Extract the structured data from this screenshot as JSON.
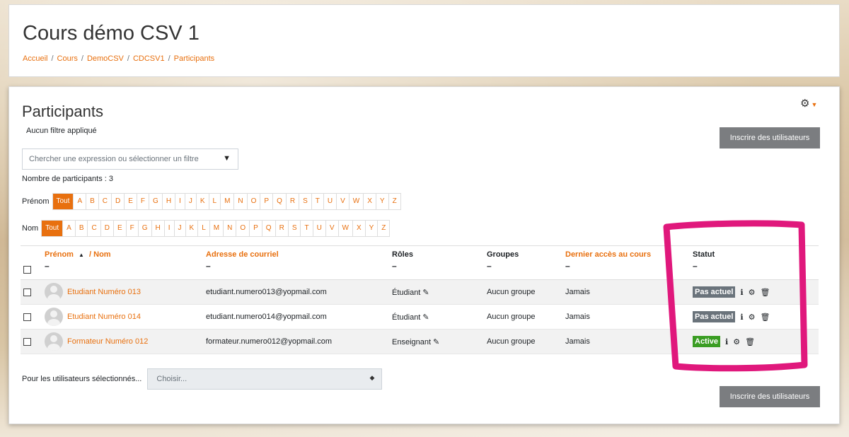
{
  "course": {
    "title": "Cours démo CSV 1",
    "breadcrumb": [
      "Accueil",
      "Cours",
      "DemoCSV",
      "CDCSV1",
      "Participants"
    ]
  },
  "page": {
    "title": "Participants",
    "filter_status": "Aucun filtre appliqué",
    "enrol_button": "Inscrire des utilisateurs",
    "search_placeholder": "Chercher une expression ou sélectionner un filtre",
    "count_text": "Nombre de participants : 3"
  },
  "initials": {
    "firstname_label": "Prénom",
    "lastname_label": "Nom",
    "all_label": "Tout",
    "letters": [
      "A",
      "B",
      "C",
      "D",
      "E",
      "F",
      "G",
      "H",
      "I",
      "J",
      "K",
      "L",
      "M",
      "N",
      "O",
      "P",
      "Q",
      "R",
      "S",
      "T",
      "U",
      "V",
      "W",
      "X",
      "Y",
      "Z"
    ]
  },
  "table": {
    "headers": {
      "firstname": "Prénom",
      "lastname": "/ Nom",
      "email": "Adresse de courriel",
      "roles": "Rôles",
      "groups": "Groupes",
      "lastaccess": "Dernier accès au cours",
      "status": "Statut",
      "dash": "–"
    },
    "rows": [
      {
        "name": "Etudiant Numéro 013",
        "email": "etudiant.numero013@yopmail.com",
        "role": "Étudiant",
        "group": "Aucun groupe",
        "lastaccess": "Jamais",
        "status": "Pas actuel"
      },
      {
        "name": "Etudiant Numéro 014",
        "email": "etudiant.numero014@yopmail.com",
        "role": "Étudiant",
        "group": "Aucun groupe",
        "lastaccess": "Jamais",
        "status": "Pas actuel"
      },
      {
        "name": "Formateur Numéro 012",
        "email": "formateur.numero012@yopmail.com",
        "role": "Enseignant",
        "group": "Aucun groupe",
        "lastaccess": "Jamais",
        "status": "Active"
      }
    ]
  },
  "bulk": {
    "label": "Pour les utilisateurs sélectionnés...",
    "placeholder": "Choisir..."
  },
  "colors": {
    "accent": "#e8700f",
    "highlight": "#e0187c",
    "inactive_badge": "#6a737b",
    "active_badge": "#3a9d23"
  },
  "icons": [
    "gear-icon",
    "sort-up-icon",
    "pencil-icon",
    "info-icon",
    "trash-icon",
    "dropdown-triangle-icon",
    "updown-icon"
  ]
}
